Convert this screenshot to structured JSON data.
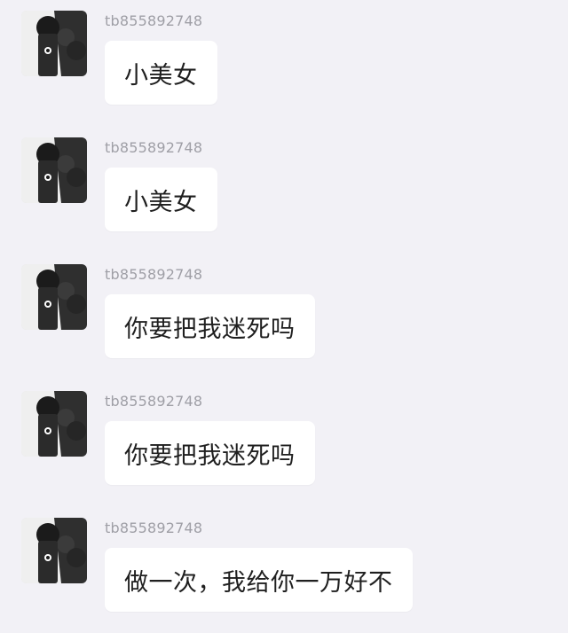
{
  "messages": [
    {
      "username": "tb855892748",
      "text": "小美女"
    },
    {
      "username": "tb855892748",
      "text": "小美女"
    },
    {
      "username": "tb855892748",
      "text": "你要把我迷死吗"
    },
    {
      "username": "tb855892748",
      "text": "你要把我迷死吗"
    },
    {
      "username": "tb855892748",
      "text": "做一次，我给你一万好不"
    }
  ],
  "colors": {
    "background": "#f2f1f6",
    "bubble": "#ffffff",
    "username": "#9f9fa6",
    "text": "#1f1f1f"
  },
  "icons": {
    "avatar": "avatar-icon"
  }
}
